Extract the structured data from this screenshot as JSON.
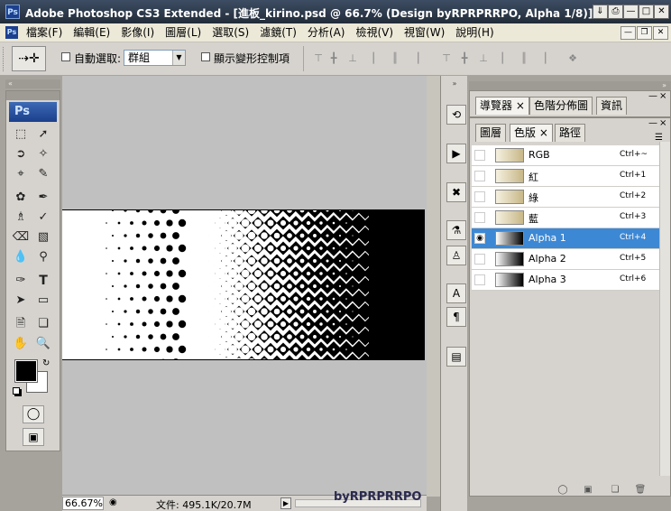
{
  "window": {
    "title": "Adobe Photoshop CS3 Extended - [進板_kirino.psd @ 66.7% (Design byRPRPRRPO, Alpha 1/8)]",
    "app_icon": "Ps",
    "controls": [
      "⇓",
      "⎙",
      "—",
      "□",
      "✕"
    ]
  },
  "menu": {
    "items": [
      "檔案(F)",
      "編輯(E)",
      "影像(I)",
      "圖層(L)",
      "選取(S)",
      "濾鏡(T)",
      "分析(A)",
      "檢視(V)",
      "視窗(W)",
      "說明(H)"
    ],
    "doc_controls": [
      "—",
      "❐",
      "✕"
    ]
  },
  "options": {
    "tool_glyph": "⇢✛",
    "auto_select_label": "自動選取:",
    "group_value": "群組",
    "show_transform_label": "顯示變形控制項"
  },
  "toolbox": {
    "badge": "Ps"
  },
  "canvas": {
    "zoom": "66.67%",
    "doc_size": "文件: 495.1K/20.7M"
  },
  "watermark": "byRPRPRRPO",
  "panels": {
    "top_tabs": [
      "導覽器",
      "色階分佈圖",
      "資訊"
    ],
    "channel_tabs": [
      "圖層",
      "色版",
      "路徑"
    ],
    "channels": [
      {
        "name": "RGB",
        "shortcut": "Ctrl+~",
        "selected": false,
        "visible": false
      },
      {
        "name": "紅",
        "shortcut": "Ctrl+1",
        "selected": false,
        "visible": false
      },
      {
        "name": "綠",
        "shortcut": "Ctrl+2",
        "selected": false,
        "visible": false
      },
      {
        "name": "藍",
        "shortcut": "Ctrl+3",
        "selected": false,
        "visible": false
      },
      {
        "name": "Alpha 1",
        "shortcut": "Ctrl+4",
        "selected": true,
        "visible": true
      },
      {
        "name": "Alpha 2",
        "shortcut": "Ctrl+5",
        "selected": false,
        "visible": false
      },
      {
        "name": "Alpha 3",
        "shortcut": "Ctrl+6",
        "selected": false,
        "visible": false
      }
    ]
  },
  "colors": {
    "selection": "#3d88d4",
    "title": "#2a3545"
  }
}
